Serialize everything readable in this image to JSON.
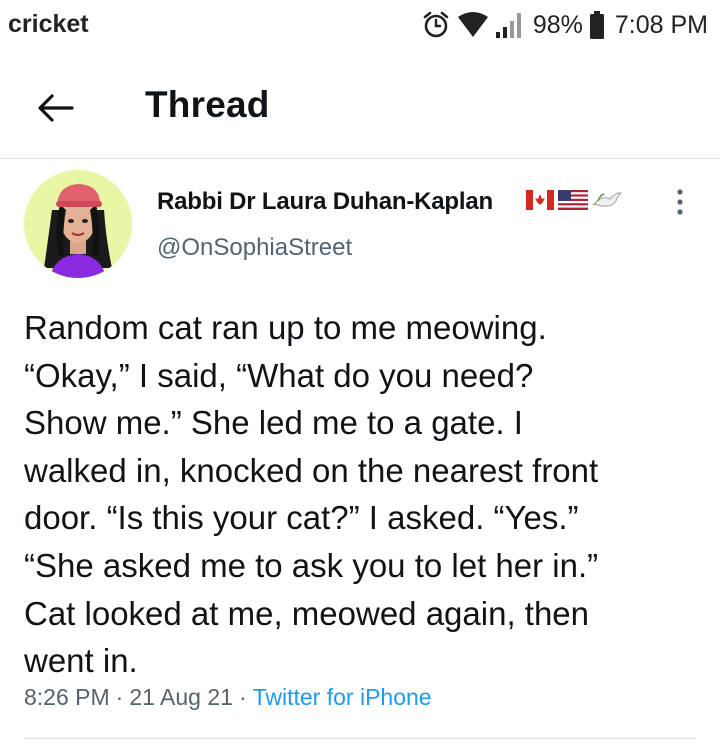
{
  "status_bar": {
    "carrier": "cricket",
    "battery": "98%",
    "time": "7:08 PM",
    "icons": [
      "alarm-icon",
      "wifi-icon",
      "signal-icon",
      "battery-icon"
    ]
  },
  "header": {
    "title": "Thread",
    "back_icon": "arrow-left-icon"
  },
  "tweet": {
    "author_name": "Rabbi Dr Laura Duhan-Kaplan",
    "handle": "@OnSophiaStreet",
    "name_emojis": [
      "canada-flag-icon",
      "usa-flag-icon",
      "dove-icon"
    ],
    "text": "Random cat ran up to me meowing.\n“Okay,” I said, “What do you need?\nShow me.” She led me to a gate. I\nwalked in, knocked on the nearest front\ndoor. “Is this your cat?” I asked. “Yes.”\n“She asked me to ask you to let her in.”\nCat looked at me, meowed again, then\nwent in.",
    "time": "8:26 PM",
    "date": "21 Aug 21",
    "source": "Twitter for iPhone",
    "separator": "·"
  },
  "colors": {
    "text": "#0f1419",
    "secondary": "#536471",
    "link": "#1d9bf0",
    "divider": "#dcdfe3"
  }
}
